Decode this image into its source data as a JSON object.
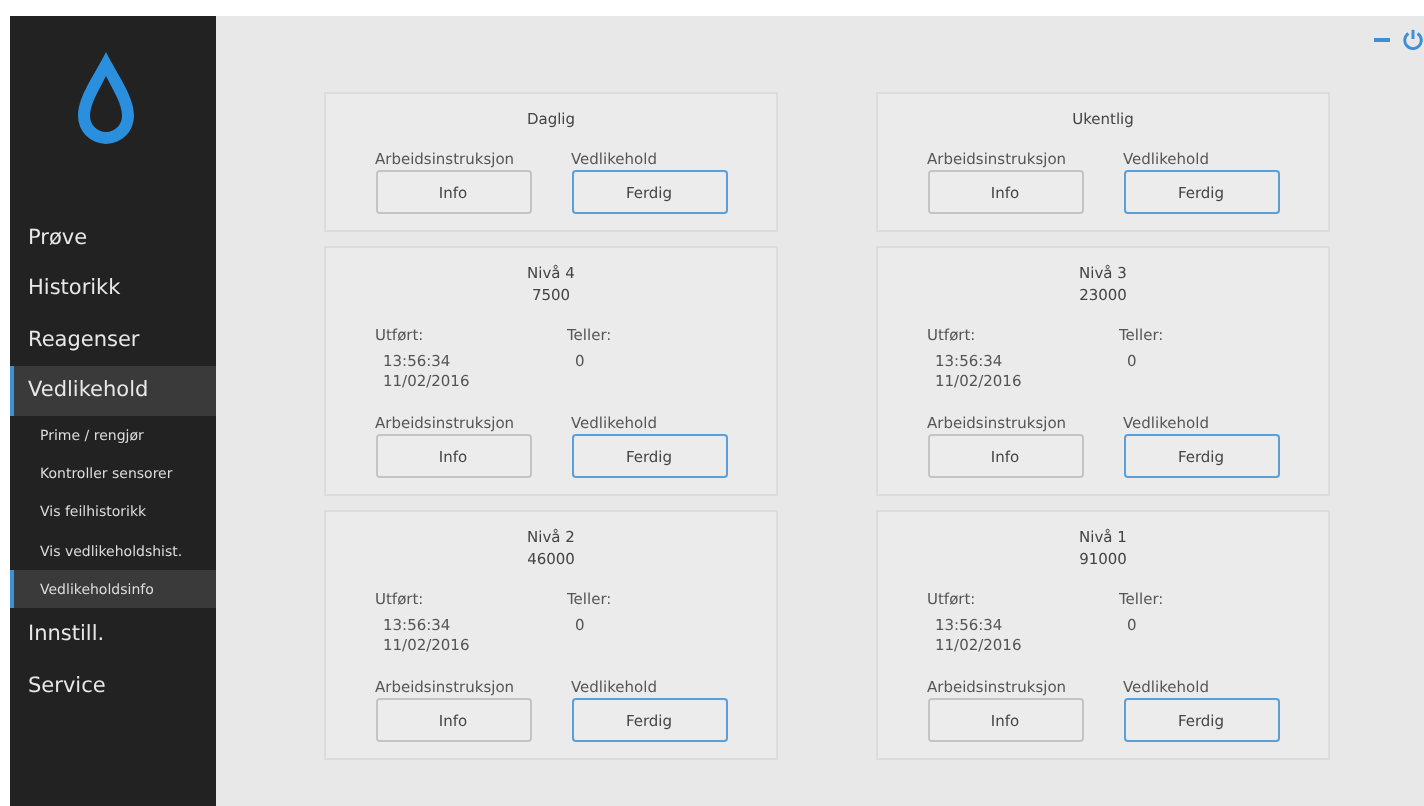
{
  "sidebar": {
    "items": [
      {
        "label": "Prøve",
        "selected": false
      },
      {
        "label": "Historikk",
        "selected": false
      },
      {
        "label": "Reagenser",
        "selected": false
      },
      {
        "label": "Vedlikehold",
        "selected": true,
        "children": [
          {
            "label": "Prime / rengjør",
            "selected": false
          },
          {
            "label": "Kontroller sensorer",
            "selected": false
          },
          {
            "label": "Vis feilhistorikk",
            "selected": false
          },
          {
            "label": "Vis vedlikeholdshist.",
            "selected": false
          },
          {
            "label": "Vedlikeholdsinfo",
            "selected": true
          }
        ]
      },
      {
        "label": "Innstill.",
        "selected": false
      },
      {
        "label": "Service",
        "selected": false
      }
    ]
  },
  "columns": [
    {
      "cards": [
        {
          "title": "Daglig",
          "instructions_label": "Arbeidsinstruksjon",
          "info_button": "Info",
          "maintenance_label": "Vedlikehold",
          "done_button": "Ferdig"
        },
        {
          "title": "Nivå 4",
          "value": "7500",
          "performed_label": "Utført:",
          "performed_time": "13:56:34",
          "performed_date": "11/02/2016",
          "counter_label": "Teller:",
          "counter_value": "0",
          "instructions_label": "Arbeidsinstruksjon",
          "info_button": "Info",
          "maintenance_label": "Vedlikehold",
          "done_button": "Ferdig"
        },
        {
          "title": "Nivå 2",
          "value": "46000",
          "performed_label": "Utført:",
          "performed_time": "13:56:34",
          "performed_date": "11/02/2016",
          "counter_label": "Teller:",
          "counter_value": "0",
          "instructions_label": "Arbeidsinstruksjon",
          "info_button": "Info",
          "maintenance_label": "Vedlikehold",
          "done_button": "Ferdig"
        }
      ]
    },
    {
      "cards": [
        {
          "title": "Ukentlig",
          "instructions_label": "Arbeidsinstruksjon",
          "info_button": "Info",
          "maintenance_label": "Vedlikehold",
          "done_button": "Ferdig"
        },
        {
          "title": "Nivå 3",
          "value": "23000",
          "performed_label": "Utført:",
          "performed_time": "13:56:34",
          "performed_date": "11/02/2016",
          "counter_label": "Teller:",
          "counter_value": "0",
          "instructions_label": "Arbeidsinstruksjon",
          "info_button": "Info",
          "maintenance_label": "Vedlikehold",
          "done_button": "Ferdig"
        },
        {
          "title": "Nivå 1",
          "value": "91000",
          "performed_label": "Utført:",
          "performed_time": "13:56:34",
          "performed_date": "11/02/2016",
          "counter_label": "Teller:",
          "counter_value": "0",
          "instructions_label": "Arbeidsinstruksjon",
          "info_button": "Info",
          "maintenance_label": "Vedlikehold",
          "done_button": "Ferdig"
        }
      ]
    }
  ]
}
